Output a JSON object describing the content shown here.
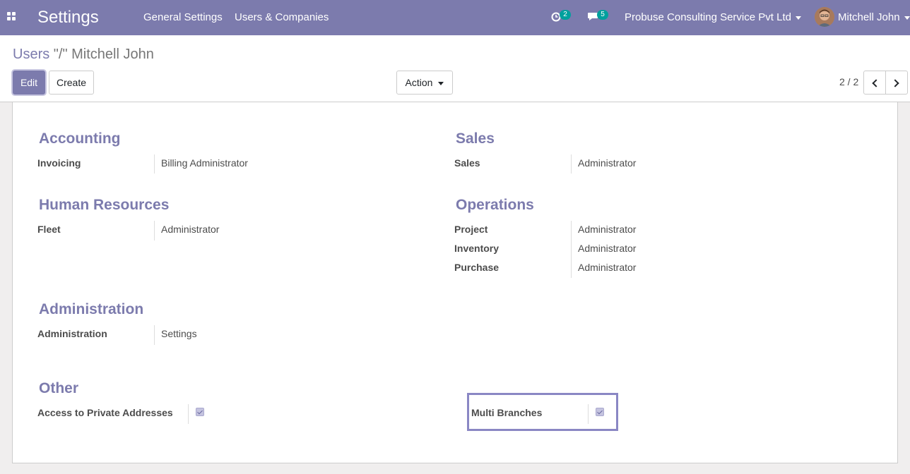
{
  "navbar": {
    "app_title": "Settings",
    "menu": [
      "General Settings",
      "Users & Companies"
    ],
    "activity_count": "2",
    "messages_count": "5",
    "company": "Probuse Consulting Service Pvt Ltd",
    "user": "Mitchell John"
  },
  "breadcrumb": {
    "parent": "Users",
    "separator": " \"/\" ",
    "current": "Mitchell John"
  },
  "toolbar": {
    "edit_label": "Edit",
    "create_label": "Create",
    "action_label": "Action",
    "pager_value": "2 / 2"
  },
  "groups": {
    "accounting": {
      "title": "Accounting",
      "fields": [
        {
          "label": "Invoicing",
          "value": "Billing Administrator"
        }
      ]
    },
    "sales": {
      "title": "Sales",
      "fields": [
        {
          "label": "Sales",
          "value": "Administrator"
        }
      ]
    },
    "human_resources": {
      "title": "Human Resources",
      "fields": [
        {
          "label": "Fleet",
          "value": "Administrator"
        }
      ]
    },
    "operations": {
      "title": "Operations",
      "fields": [
        {
          "label": "Project",
          "value": "Administrator"
        },
        {
          "label": "Inventory",
          "value": "Administrator"
        },
        {
          "label": "Purchase",
          "value": "Administrator"
        }
      ]
    },
    "administration": {
      "title": "Administration",
      "fields": [
        {
          "label": "Administration",
          "value": "Settings"
        }
      ]
    },
    "other": {
      "title": "Other",
      "fields": [
        {
          "label": "Access to Private Addresses",
          "checked": true
        },
        {
          "label": "Multi Branches",
          "checked": true
        }
      ]
    }
  },
  "colors": {
    "brand": "#7c7bad",
    "badge": "#00a09d",
    "highlight": "#8a87c4"
  }
}
